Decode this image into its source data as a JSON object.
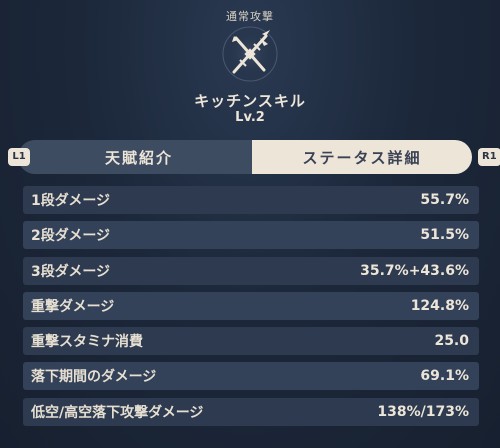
{
  "header": {
    "category": "通常攻撃",
    "icon": "crossed-spear-icon",
    "talent_name": "キッチンスキル",
    "level": "Lv.2"
  },
  "tabs": {
    "left_hint": "L1",
    "right_hint": "R1",
    "items": [
      {
        "label": "天賦紹介",
        "active": false
      },
      {
        "label": "ステータス詳細",
        "active": true
      }
    ]
  },
  "stats": [
    {
      "label": "1段ダメージ",
      "value": "55.7%"
    },
    {
      "label": "2段ダメージ",
      "value": "51.5%"
    },
    {
      "label": "3段ダメージ",
      "value": "35.7%+43.6%"
    },
    {
      "label": "重撃ダメージ",
      "value": "124.8%"
    },
    {
      "label": "重撃スタミナ消費",
      "value": "25.0"
    },
    {
      "label": "落下期間のダメージ",
      "value": "69.1%"
    },
    {
      "label": "低空/高空落下攻撃ダメージ",
      "value": "138%/173%"
    }
  ],
  "colors": {
    "background": "#1c283b",
    "text": "#ece5d8",
    "tab_active_bg": "#ece5d8",
    "tab_inactive_bg": "#3e4c62"
  }
}
